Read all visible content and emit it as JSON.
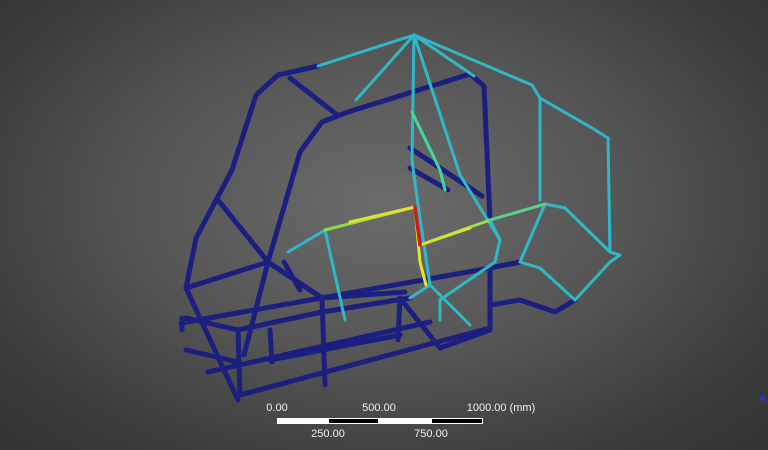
{
  "viewport": {
    "background_center": "#6b6b6b",
    "background_edge": "#333333"
  },
  "model": {
    "name": "",
    "colors": {
      "low": "#1a1f7a",
      "low_mid": "#2aa5c0",
      "mid": "#3ad6c8",
      "mid_high": "#7ee04a",
      "high": "#e6e62a",
      "peak": "#c81e1e"
    }
  },
  "scale_bar": {
    "top_labels": [
      "0.00",
      "500.00",
      "1000.00 (mm)"
    ],
    "bottom_labels": [
      "250.00",
      "750.00"
    ],
    "segment_colors": [
      "#ffffff",
      "#000000",
      "#ffffff",
      "#000000"
    ]
  }
}
